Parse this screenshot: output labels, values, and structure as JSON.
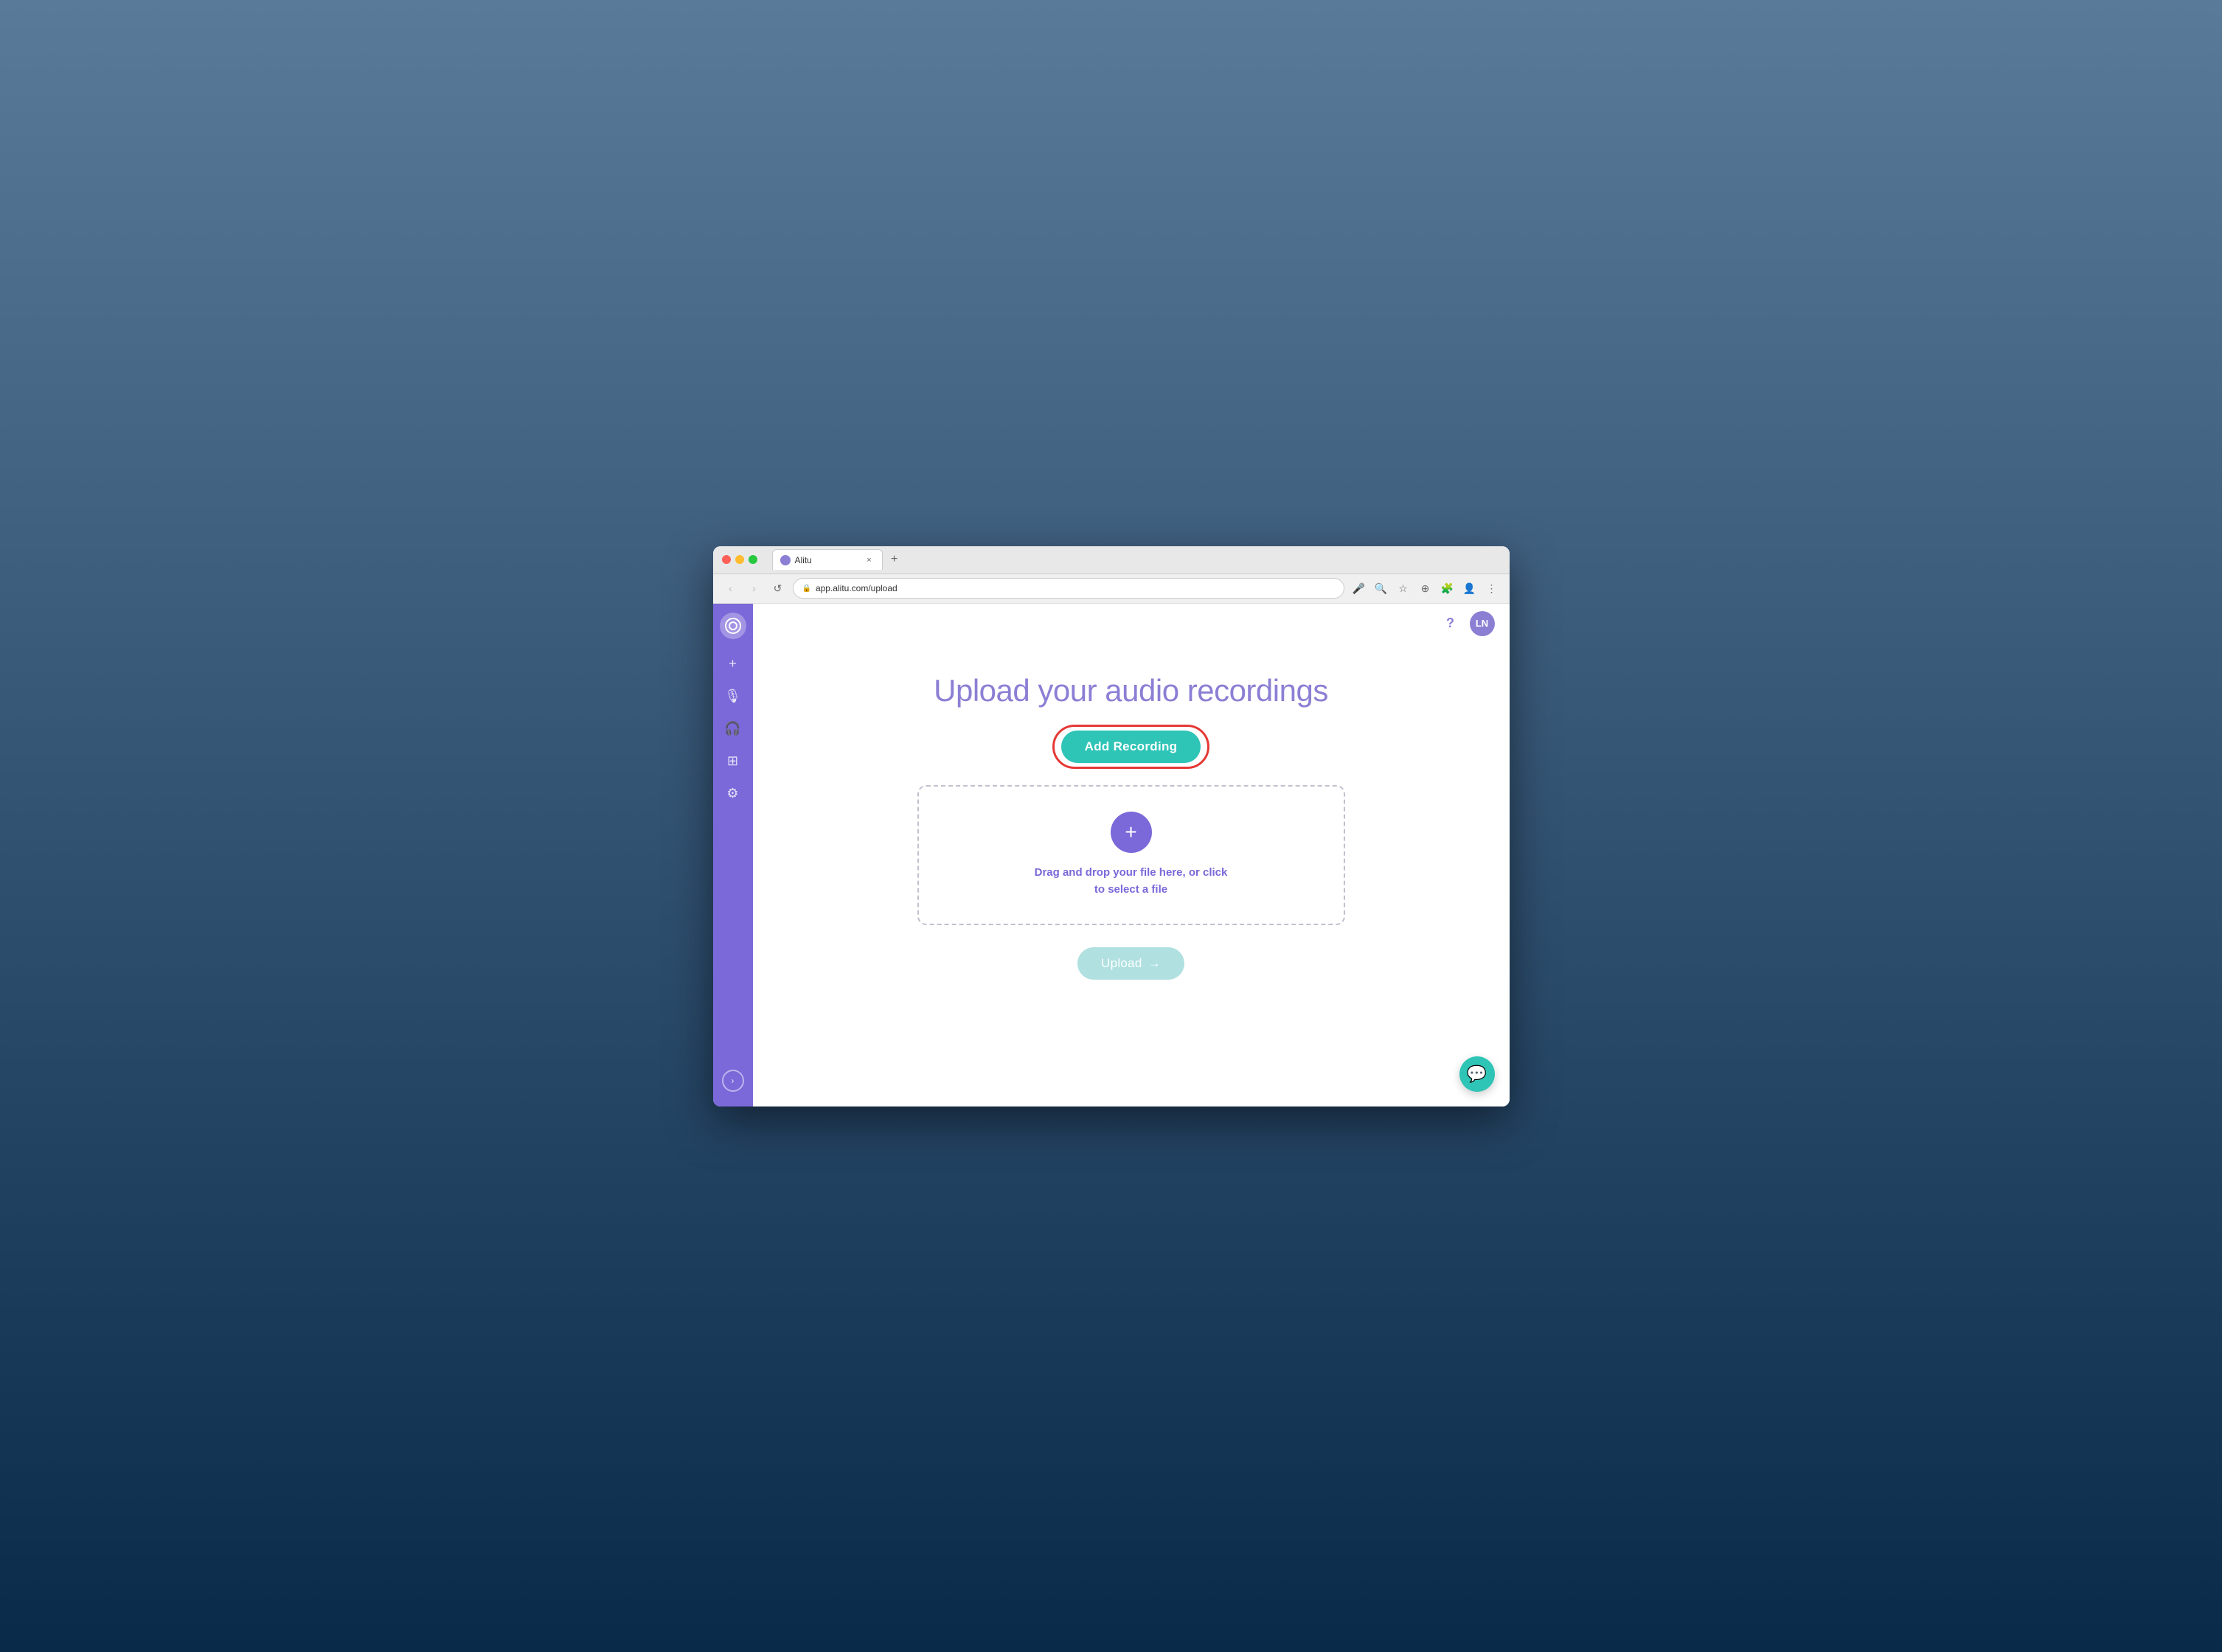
{
  "desktop": {
    "bg_description": "macOS landscape background"
  },
  "browser": {
    "tab_title": "Alitu",
    "tab_favicon_alt": "alitu-favicon",
    "url": "app.alitu.com/upload",
    "new_tab_label": "+",
    "tab_close_label": "×"
  },
  "nav": {
    "back": "‹",
    "forward": "›",
    "refresh": "↺",
    "lock_icon": "🔒",
    "mic_icon": "🎤",
    "search_icon": "🔍",
    "star_icon": "☆",
    "zoom_icon": "⊕",
    "extension_icon": "⊞",
    "account_icon": "👤",
    "more_icon": "⋮"
  },
  "sidebar": {
    "logo_alt": "alitu-logo",
    "items": [
      {
        "id": "add",
        "icon": "+",
        "label": "Add"
      },
      {
        "id": "record",
        "icon": "🎙",
        "label": "Record"
      },
      {
        "id": "headphones",
        "icon": "🎧",
        "label": "Listen"
      },
      {
        "id": "grid",
        "icon": "⊞",
        "label": "Grid"
      },
      {
        "id": "settings",
        "icon": "⚙",
        "label": "Settings"
      }
    ],
    "expand_icon": "›"
  },
  "header": {
    "help_label": "?",
    "user_initials": "LN"
  },
  "main": {
    "page_title": "Upload your audio recordings",
    "add_recording_label": "Add Recording",
    "drop_zone_text": "Drag and drop your file here, or click\nto select a file",
    "drop_plus_icon": "+",
    "upload_label": "Upload",
    "upload_arrow": "→",
    "chat_icon": "💬"
  },
  "colors": {
    "sidebar_bg": "#7b68d9",
    "accent_purple": "#8b7fd4",
    "accent_teal": "#2ec4b6",
    "upload_disabled": "#b0e0e0",
    "red_highlight": "#e53935",
    "drop_border": "#c0c0d0",
    "title_color": "#8b7fd4"
  }
}
